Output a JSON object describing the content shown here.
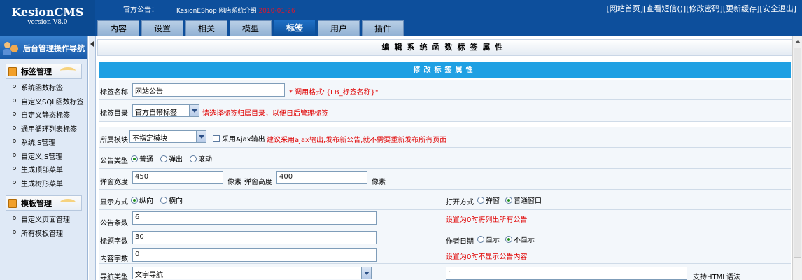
{
  "header": {
    "logo_name": "KesionCMS",
    "logo_version": "version V8.0",
    "notice_label": "官方公告：",
    "notice_text": "KesionEShop 网店系统介绍 ",
    "notice_date": "2010-01-26",
    "links": [
      "[网站首页]",
      "[查看短信(",
      ")]",
      "[修改密码]",
      "[更新缓存]",
      "[安全退出]"
    ]
  },
  "tabs": [
    {
      "label": "内容",
      "active": false
    },
    {
      "label": "设置",
      "active": false
    },
    {
      "label": "相关",
      "active": false
    },
    {
      "label": "模型",
      "active": false
    },
    {
      "label": "标签",
      "active": true
    },
    {
      "label": "用户",
      "active": false
    },
    {
      "label": "插件",
      "active": false
    }
  ],
  "sidebar": {
    "title": "后台管理操作导航",
    "groups": [
      {
        "title": "标签管理",
        "items": [
          "系统函数标签",
          "自定义SQL函数标签",
          "自定义静态标签",
          "通用循环列表标签",
          "系统JS管理",
          "自定义JS管理",
          "生成顶部菜单",
          "生成树形菜单"
        ]
      },
      {
        "title": "模板管理",
        "items": [
          "自定义页面管理",
          "所有模板管理"
        ]
      }
    ]
  },
  "page": {
    "title": "编辑系统函数标签属性",
    "section_title": "修改标签属性"
  },
  "form": {
    "tag_name_label": "标签名称",
    "tag_name_value": "网站公告",
    "tag_name_hint": "* 调用格式\"{LB_标签名称}\"",
    "tag_dir_label": "标签目录",
    "tag_dir_value": "官方自带标签",
    "tag_dir_hint": "请选择标签归属目录，以便日后管理标签",
    "module_label": "所属模块",
    "module_value": "不指定模块",
    "ajax_label": "采用Ajax输出",
    "ajax_hint": "建议采用ajax输出,发布新公告,就不需要重新发布所有页面",
    "type_label": "公告类型",
    "type_options": [
      "普通",
      "弹出",
      "滚动"
    ],
    "popup_width_label": "弹窗宽度",
    "popup_width_value": "450",
    "px_unit": "像素",
    "popup_height_label": "弹窗高度",
    "popup_height_value": "400",
    "display_label": "显示方式",
    "display_options": [
      "纵向",
      "横向"
    ],
    "open_label": "打开方式",
    "open_options": [
      "弹窗",
      "普通窗口"
    ],
    "count_label": "公告条数",
    "count_value": "6",
    "count_hint": "设置为0时将列出所有公告",
    "title_len_label": "标题字数",
    "title_len_value": "30",
    "author_label": "作者日期",
    "author_options": [
      "显示",
      "不显示"
    ],
    "content_len_label": "内容字数",
    "content_len_value": "0",
    "content_hint": "设置为0时不显示公告内容",
    "nav_label": "导航类型",
    "nav_value": "文字导航",
    "nav_text_value": "·",
    "html_hint": "支持HTML语法"
  }
}
